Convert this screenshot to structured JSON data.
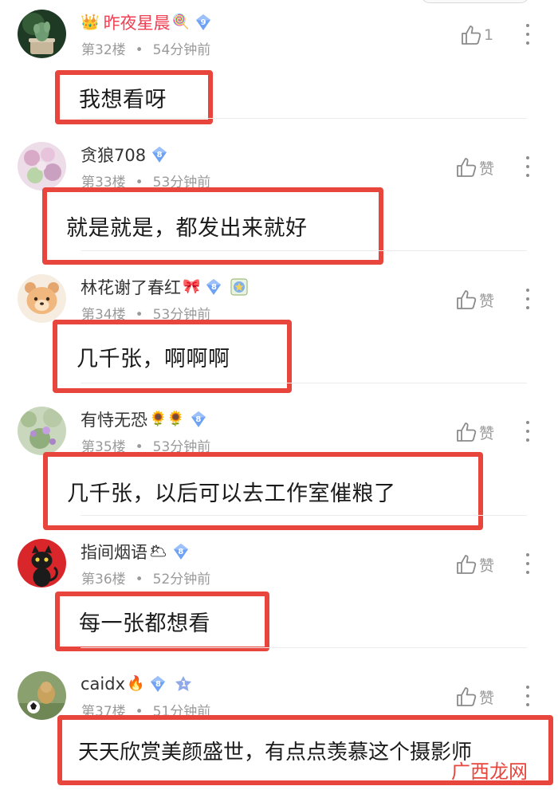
{
  "comments": [
    {
      "username": "昨夜星晨",
      "vip": true,
      "name_emoji": "🍭",
      "crown_emoji": "👑",
      "level": "9",
      "floor": "第32楼",
      "time": "54分钟前",
      "like_label": "1",
      "text": "我想看呀"
    },
    {
      "username": "贪狼708",
      "vip": false,
      "name_emoji": "",
      "level": "8",
      "floor": "第33楼",
      "time": "53分钟前",
      "like_label": "赞",
      "text": "就是就是，都发出来就好"
    },
    {
      "username": "林花谢了春红",
      "vip": false,
      "name_emoji": "🎀",
      "level": "8",
      "extra_badge": "star-badge",
      "floor": "第34楼",
      "time": "53分钟前",
      "like_label": "赞",
      "text": "几千张，啊啊啊"
    },
    {
      "username": "有恃无恐",
      "vip": false,
      "name_emoji": "🌻🌻",
      "level": "8",
      "floor": "第35楼",
      "time": "53分钟前",
      "like_label": "赞",
      "text": "几千张，以后可以去工作室催粮了"
    },
    {
      "username": "指间烟语",
      "vip": false,
      "name_emoji": "🌥",
      "level": "8",
      "floor": "第36楼",
      "time": "52分钟前",
      "like_label": "赞",
      "text": "每一张都想看"
    },
    {
      "username": "caidx",
      "vip": false,
      "name_emoji": "🔥",
      "level": "8",
      "extra_badge": "rank-1-badge",
      "extra_badge_text": "1",
      "floor": "第37楼",
      "time": "51分钟前",
      "like_label": "赞",
      "text": "天天欣赏美颜盛世，有点点羡慕这个摄影师"
    }
  ],
  "meta_separator": "•",
  "watermark": "广西龙网",
  "colors": {
    "highlight_border": "#e8453c",
    "vip_name": "#f03e52",
    "level_badge": "#6ea2f5",
    "level_badge_gold": "#8fb6f7",
    "meta_text": "#9a9a9a"
  }
}
